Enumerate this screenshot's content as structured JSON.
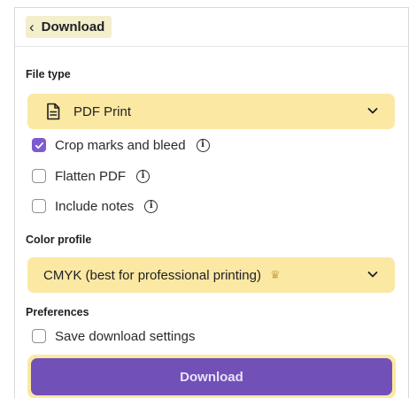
{
  "header": {
    "back_label": "Download"
  },
  "file_type": {
    "label": "File type",
    "value": "PDF Print"
  },
  "options": [
    {
      "label": "Crop marks and bleed",
      "checked": true
    },
    {
      "label": "Flatten PDF",
      "checked": false
    },
    {
      "label": "Include notes",
      "checked": false
    }
  ],
  "color_profile": {
    "label": "Color profile",
    "value": "CMYK (best for professional printing)"
  },
  "preferences": {
    "label": "Preferences",
    "save_settings_label": "Save download settings",
    "save_settings_checked": false
  },
  "download_button": {
    "label": "Download"
  },
  "colors": {
    "accent": "#7150b8",
    "checkbox_checked": "#7d5bd0",
    "highlight": "#fbe8a3"
  },
  "icons": {
    "back": "chevron-left-icon",
    "file": "document-icon",
    "dropdown": "chevron-down-icon",
    "info": "info-icon",
    "premium": "crown-icon",
    "check": "checkmark-icon"
  }
}
